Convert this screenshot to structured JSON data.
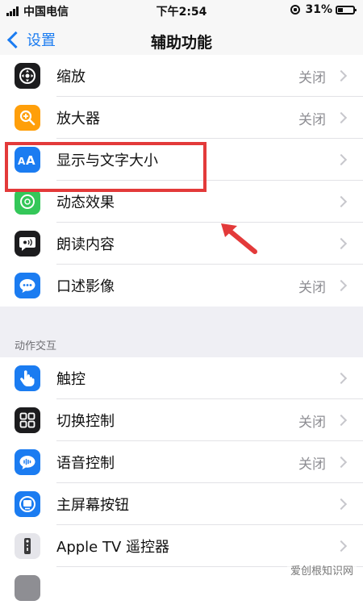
{
  "status_bar": {
    "carrier": "中国电信",
    "time": "下午2:54",
    "battery": "31%"
  },
  "nav": {
    "back_label": "设置",
    "title": "辅助功能"
  },
  "group1": {
    "items": [
      {
        "label": "缩放",
        "value": "关闭",
        "icon": "zoom-icon",
        "color": "#1c1c1e"
      },
      {
        "label": "放大器",
        "value": "关闭",
        "icon": "magnifier-icon",
        "color": "#ff9f0a"
      },
      {
        "label": "显示与文字大小",
        "value": "",
        "icon": "text-size-icon",
        "color": "#1b7cf1"
      },
      {
        "label": "动态效果",
        "value": "",
        "icon": "motion-icon",
        "color": "#34c759"
      },
      {
        "label": "朗读内容",
        "value": "",
        "icon": "speech-icon",
        "color": "#1c1c1e"
      },
      {
        "label": "口述影像",
        "value": "关闭",
        "icon": "audio-description-icon",
        "color": "#1b7cf1"
      }
    ]
  },
  "section2": {
    "header": "动作交互",
    "items": [
      {
        "label": "触控",
        "value": "",
        "icon": "touch-icon",
        "color": "#1b7cf1"
      },
      {
        "label": "切换控制",
        "value": "关闭",
        "icon": "switch-control-icon",
        "color": "#1c1c1e"
      },
      {
        "label": "语音控制",
        "value": "关闭",
        "icon": "voice-control-icon",
        "color": "#1b7cf1"
      },
      {
        "label": "主屏幕按钮",
        "value": "",
        "icon": "home-button-icon",
        "color": "#1b7cf1"
      },
      {
        "label": "Apple TV 遥控器",
        "value": "",
        "icon": "tv-remote-icon",
        "color": "#8e8e93"
      }
    ]
  },
  "annotation": {
    "color": "#e33a3a"
  },
  "watermark": "爱创根知识网"
}
